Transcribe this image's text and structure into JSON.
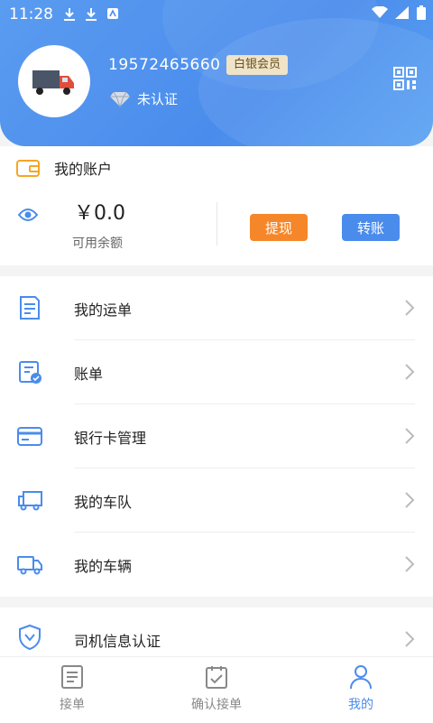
{
  "status_bar": {
    "time": "11:28"
  },
  "profile": {
    "phone": "19572465660",
    "member_badge": "白银会员",
    "cert_status": "未认证",
    "avatar_icon": "truck-icon",
    "qr_icon": "qr-code-icon"
  },
  "account": {
    "title": "我的账户",
    "balance": "￥0.0",
    "balance_label": "可用余额",
    "withdraw_label": "提现",
    "transfer_label": "转账"
  },
  "menu": {
    "items": [
      {
        "label": "我的运单",
        "icon": "document-icon"
      },
      {
        "label": "账单",
        "icon": "bill-icon"
      },
      {
        "label": "银行卡管理",
        "icon": "bank-card-icon"
      },
      {
        "label": "我的车队",
        "icon": "fleet-icon"
      },
      {
        "label": "我的车辆",
        "icon": "vehicle-icon"
      }
    ],
    "extra_items": [
      {
        "label": "司机信息认证",
        "icon": "shield-icon"
      }
    ]
  },
  "tabs": [
    {
      "label": "接单",
      "icon": "order-icon",
      "active": false
    },
    {
      "label": "确认接单",
      "icon": "confirm-order-icon",
      "active": false
    },
    {
      "label": "我的",
      "icon": "user-icon",
      "active": true
    }
  ],
  "colors": {
    "primary": "#4a8cec",
    "orange": "#f5872a",
    "badge_bg": "#efe3c8"
  }
}
